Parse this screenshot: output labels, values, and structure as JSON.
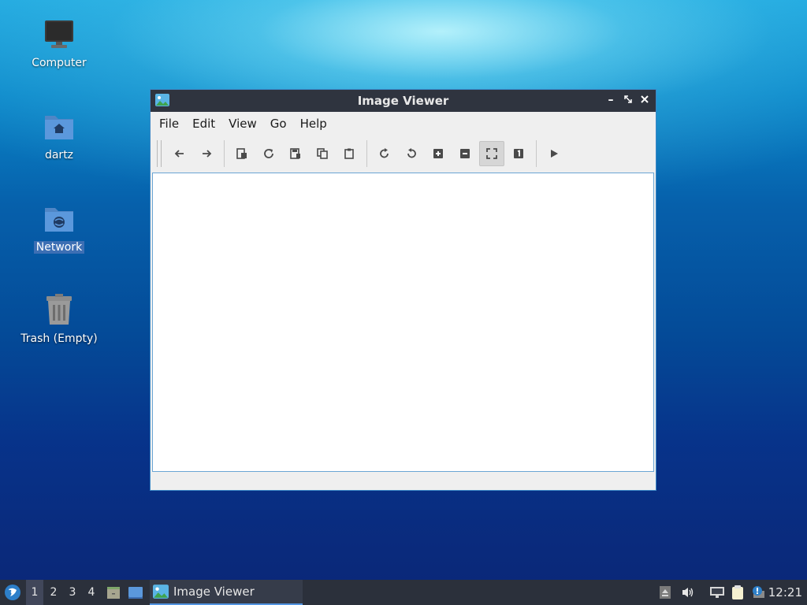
{
  "desktop": {
    "icons": [
      {
        "label": "Computer",
        "icon": "monitor-icon"
      },
      {
        "label": "dartz",
        "icon": "home-folder-icon"
      },
      {
        "label": "Network",
        "icon": "network-folder-icon",
        "selected": true
      },
      {
        "label": "Trash (Empty)",
        "icon": "trash-icon"
      }
    ]
  },
  "window": {
    "title": "Image Viewer",
    "menu": [
      "File",
      "Edit",
      "View",
      "Go",
      "Help"
    ],
    "toolbar": [
      {
        "icon": "arrow-left-icon"
      },
      {
        "icon": "arrow-right-icon"
      },
      {
        "icon": "open-file-icon"
      },
      {
        "icon": "reload-icon"
      },
      {
        "icon": "save-icon"
      },
      {
        "icon": "copy-icon"
      },
      {
        "icon": "paste-icon"
      },
      {
        "icon": "rotate-clockwise-icon"
      },
      {
        "icon": "rotate-counterclockwise-icon"
      },
      {
        "icon": "zoom-in-icon"
      },
      {
        "icon": "zoom-out-icon"
      },
      {
        "icon": "fit-window-icon",
        "active": true
      },
      {
        "icon": "original-size-icon"
      },
      {
        "icon": "slideshow-play-icon"
      }
    ]
  },
  "taskbar": {
    "workspaces": [
      "1",
      "2",
      "3",
      "4"
    ],
    "current_workspace": "1",
    "task_label": "Image Viewer",
    "clock": "12:21"
  },
  "colors": {
    "titlebar": "#2f343f",
    "taskbar": "#2b303b",
    "accent": "#5294e2",
    "selection": "#3d6fb4"
  }
}
